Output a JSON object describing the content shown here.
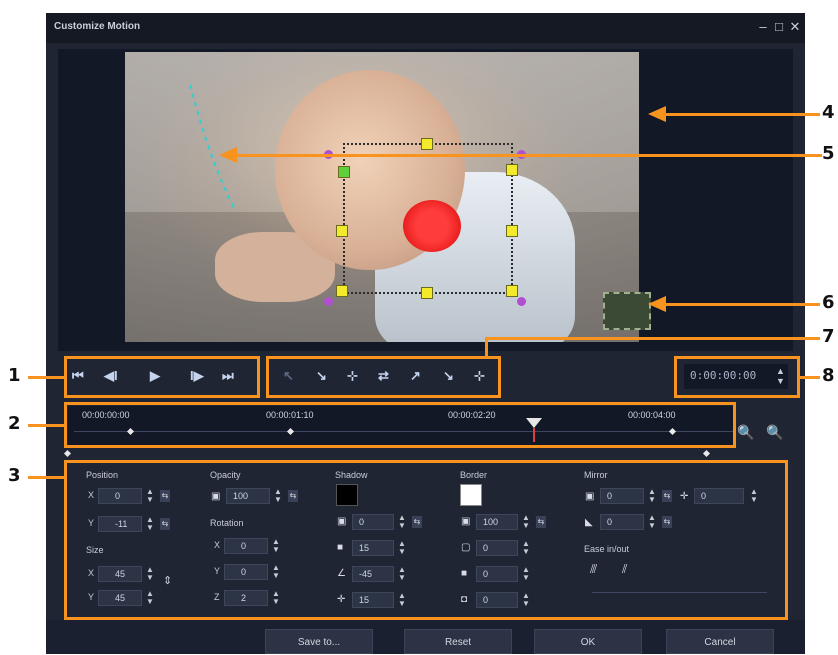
{
  "window": {
    "title": "Customize Motion",
    "minimize": "–",
    "maximize": "□",
    "close": "✕"
  },
  "transport": {
    "home": "⏮",
    "prev_frame": "◀I",
    "play": "▶",
    "next_frame": "I▶",
    "end": "⏭"
  },
  "tools": [
    "↖",
    "↘",
    "⊹",
    "⇄",
    "↗",
    "↘",
    "⊹"
  ],
  "timecode_value": "0:00:00:00",
  "timeline": {
    "marks": [
      "00:00:00:00",
      "00:00:01:10",
      "00:00:02:20",
      "00:00:04:00"
    ]
  },
  "panels": {
    "position": {
      "label": "Position",
      "x_label": "X",
      "x_value": "0",
      "y_label": "Y",
      "y_value": "-11"
    },
    "size": {
      "label": "Size",
      "x_label": "X",
      "x_value": "45",
      "y_label": "Y",
      "y_value": "45"
    },
    "opacity": {
      "label": "Opacity",
      "value": "100"
    },
    "rotation": {
      "label": "Rotation",
      "x_label": "X",
      "x_value": "0",
      "y_label": "Y",
      "y_value": "0",
      "z_label": "Z",
      "z_value": "2"
    },
    "shadow": {
      "label": "Shadow",
      "v1": "0",
      "v2": "15",
      "v3": "-45",
      "v4": "15"
    },
    "border": {
      "label": "Border",
      "v1": "100",
      "v2": "0",
      "v3": "0",
      "v4": "0"
    },
    "mirror": {
      "label": "Mirror",
      "v1": "0",
      "v2": "0",
      "v3": "0"
    },
    "ease": {
      "label": "Ease in/out"
    }
  },
  "footer": {
    "save_to": "Save to...",
    "reset": "Reset",
    "ok": "OK",
    "cancel": "Cancel"
  },
  "callouts": [
    "1",
    "2",
    "3",
    "4",
    "5",
    "6",
    "7",
    "8"
  ],
  "colors": {
    "accent": "#f7931e",
    "window_bg": "#1f2533",
    "handle": "#f2ea2b"
  }
}
